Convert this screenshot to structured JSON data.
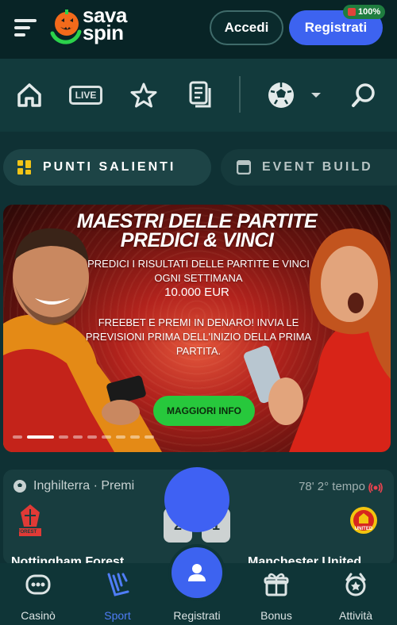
{
  "header": {
    "logo_text_line1": "sava",
    "logo_text_line2": "spin",
    "login_label": "Accedi",
    "register_label": "Registrati",
    "badge_label": "100%"
  },
  "nav": {
    "live_label": "LIVE",
    "icons": [
      "home-icon",
      "live-icon",
      "star-icon",
      "betslip-icon",
      "football-icon",
      "chevron-down-icon",
      "search-icon"
    ]
  },
  "pills": {
    "active_label": "PUNTI SALIENTI",
    "inactive_label": "EVENT BUILD"
  },
  "banner": {
    "title_line1": "MAESTRI DELLE PARTITE",
    "title_line2": "PREDICI & VINCI",
    "text1_line1": "PREDICI I RISULTATI DELLE PARTITE E VINCI",
    "text1_line2": "OGNI SETTIMANA",
    "amount": "10.000 EUR",
    "text2_line1": "FREEBET E PREMI IN DENARO! INVIA LE",
    "text2_line2": "PREVISIONI PRIMA DELL'INIZIO DELLA PRIMA",
    "text2_line3": "PARTITA.",
    "cta_label": "MAGGIORI INFO",
    "slide_count": 9,
    "active_slide": 2
  },
  "match": {
    "competition": "Inghilterra · Premi",
    "competition_tail": "e",
    "time": "78' 2° tempo",
    "home_team": "Nottingham Forest",
    "away_team": "Manchester United",
    "home_score": "2",
    "away_score": "1",
    "home_crest_text": "FOREST",
    "away_crest_text": "UNITED"
  },
  "bottom_nav": {
    "items": [
      {
        "label": "Casinò",
        "icon": "casino-icon"
      },
      {
        "label": "Sport",
        "icon": "sport-icon"
      },
      {
        "label": "Registrati",
        "icon": "user-icon"
      },
      {
        "label": "Bonus",
        "icon": "gift-icon"
      },
      {
        "label": "Attività",
        "icon": "activity-icon"
      }
    ]
  },
  "colors": {
    "accent_blue": "#3d63f0",
    "cta_green": "#27c83c",
    "background": "#0f3134"
  }
}
